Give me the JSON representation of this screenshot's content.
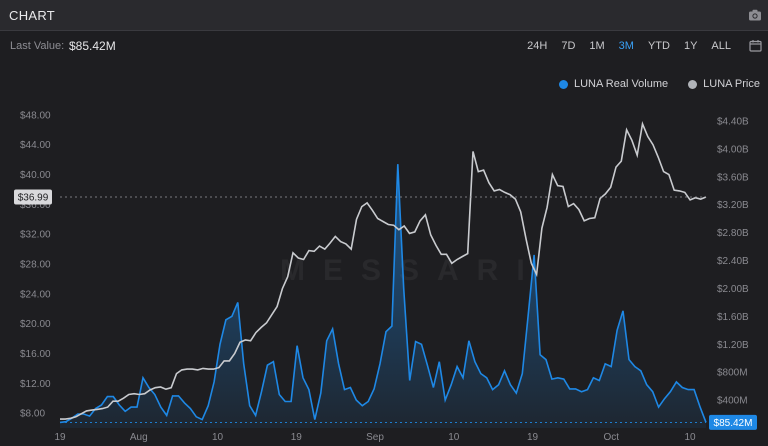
{
  "header": {
    "title": "CHART",
    "camera_icon": "camera-icon"
  },
  "toolbar": {
    "last_value_label": "Last Value:",
    "last_value": "$85.42M",
    "ranges": [
      "24H",
      "7D",
      "1M",
      "3M",
      "YTD",
      "1Y",
      "ALL"
    ],
    "active_range": "3M",
    "calendar_icon": "calendar-icon"
  },
  "legend": [
    {
      "label": "LUNA Real Volume",
      "color": "#1e88e5"
    },
    {
      "label": "LUNA Price",
      "color": "#b0b3b8"
    }
  ],
  "watermark": "MESSARI",
  "colors": {
    "accent": "#3aa0f5",
    "volume": "#1e88e5",
    "price": "#c9cbcf",
    "background": "#1e1e21"
  },
  "chart_data": {
    "type": "line",
    "x_tick_labels": [
      "19",
      "Aug",
      "10",
      "19",
      "Sep",
      "10",
      "19",
      "Oct",
      "10"
    ],
    "left_axis": {
      "labels": [
        "$8.00",
        "$12.00",
        "$16.00",
        "$20.00",
        "$24.00",
        "$28.00",
        "$32.00",
        "$36.00",
        "$40.00",
        "$44.00",
        "$48.00"
      ],
      "ylim": [
        6,
        50
      ]
    },
    "right_axis": {
      "labels": [
        "$400M",
        "$800M",
        "$1.20B",
        "$1.60B",
        "$2.00B",
        "$2.40B",
        "$2.80B",
        "$3.20B",
        "$3.60B",
        "$4.00B",
        "$4.40B"
      ],
      "ylim": [
        0,
        4.7
      ]
    },
    "price_marker": "$36.99",
    "volume_marker": "$85.42M",
    "series": [
      {
        "name": "LUNA Price",
        "axis": "left",
        "values": [
          7.2,
          7.2,
          7.3,
          7.5,
          7.9,
          8.3,
          8.4,
          8.5,
          8.6,
          8.8,
          9.6,
          9.6,
          10,
          10.5,
          10.6,
          10.5,
          10.6,
          11.1,
          11.4,
          11.5,
          11.2,
          11.4,
          13.3,
          13.8,
          13.9,
          13.9,
          13.8,
          14.0,
          13.9,
          13.9,
          14.1,
          15.0,
          15.0,
          16.0,
          17.5,
          17.8,
          17.7,
          18.8,
          19.5,
          20.1,
          21.2,
          22.3,
          24.7,
          26.3,
          29.5,
          28.8,
          28.6,
          29.8,
          29.7,
          30.4,
          30.0,
          30.8,
          31.7,
          31.0,
          30.7,
          30.0,
          34.0,
          35.7,
          36.2,
          35.2,
          34.1,
          33.7,
          33.3,
          33.2,
          32.6,
          33.1,
          32.1,
          32.3,
          33.8,
          34.6,
          31.9,
          30.5,
          29.3,
          29.3,
          28.1,
          28.6,
          29.0,
          29.4,
          43.1,
          40.4,
          40.6,
          38.9,
          37.8,
          38.0,
          37.6,
          37.3,
          36.7,
          35.0,
          31.4,
          28.1,
          26.6,
          32.8,
          35.6,
          40.0,
          38.5,
          38.4,
          35.7,
          36.1,
          35.3,
          33.8,
          34.1,
          34.2,
          36.8,
          37.4,
          38.3,
          41.0,
          41.8,
          46.0,
          44.6,
          42.6,
          46.8,
          45.1,
          44.0,
          42.3,
          40.4,
          40.0,
          37.9,
          37.8,
          37.6,
          36.6,
          36.9,
          36.7,
          36.99
        ]
      },
      {
        "name": "LUNA Real Volume",
        "axis": "right",
        "values": [
          0.08,
          0.09,
          0.14,
          0.2,
          0.2,
          0.17,
          0.28,
          0.33,
          0.45,
          0.45,
          0.33,
          0.24,
          0.3,
          0.3,
          0.72,
          0.58,
          0.48,
          0.3,
          0.18,
          0.46,
          0.46,
          0.36,
          0.28,
          0.16,
          0.12,
          0.32,
          0.66,
          1.2,
          1.55,
          1.6,
          1.8,
          0.92,
          0.32,
          0.18,
          0.52,
          0.9,
          0.95,
          0.48,
          0.38,
          0.38,
          1.18,
          0.72,
          0.55,
          0.12,
          0.5,
          1.25,
          1.42,
          0.92,
          0.55,
          0.58,
          0.4,
          0.32,
          0.38,
          0.56,
          0.92,
          1.38,
          1.46,
          3.78,
          2.0,
          0.68,
          1.24,
          1.2,
          0.9,
          0.58,
          0.95,
          0.4,
          0.62,
          0.88,
          0.72,
          1.25,
          0.95,
          0.78,
          0.72,
          0.55,
          0.62,
          0.82,
          0.62,
          0.5,
          0.78,
          1.62,
          2.48,
          1.05,
          0.98,
          0.7,
          0.72,
          0.7,
          0.56,
          0.56,
          0.52,
          0.55,
          0.72,
          0.68,
          0.92,
          0.88,
          1.4,
          1.68,
          0.98,
          0.88,
          0.82,
          0.62,
          0.52,
          0.3,
          0.42,
          0.52,
          0.66,
          0.58,
          0.55,
          0.55,
          0.3,
          0.08
        ]
      }
    ]
  }
}
